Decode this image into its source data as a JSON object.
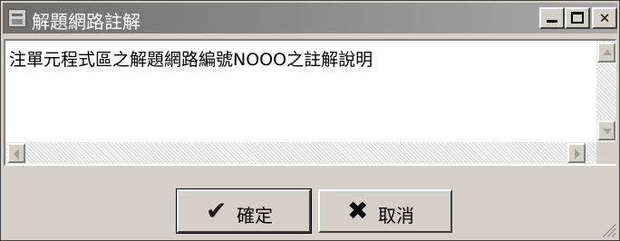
{
  "window": {
    "title": "解題網路註解",
    "controls": {
      "minimize": "_",
      "maximize": "□",
      "close": "✕"
    }
  },
  "editor": {
    "text": "注單元程式區之解題網路編號NOOO之註解說明"
  },
  "buttons": {
    "ok_label": "確定",
    "ok_icon": "✔",
    "cancel_label": "取消",
    "cancel_icon": "✖"
  },
  "colors": {
    "titlebar_start": "#6e6e6e",
    "titlebar_end": "#a9a9a9",
    "face": "#d4d0c8"
  }
}
